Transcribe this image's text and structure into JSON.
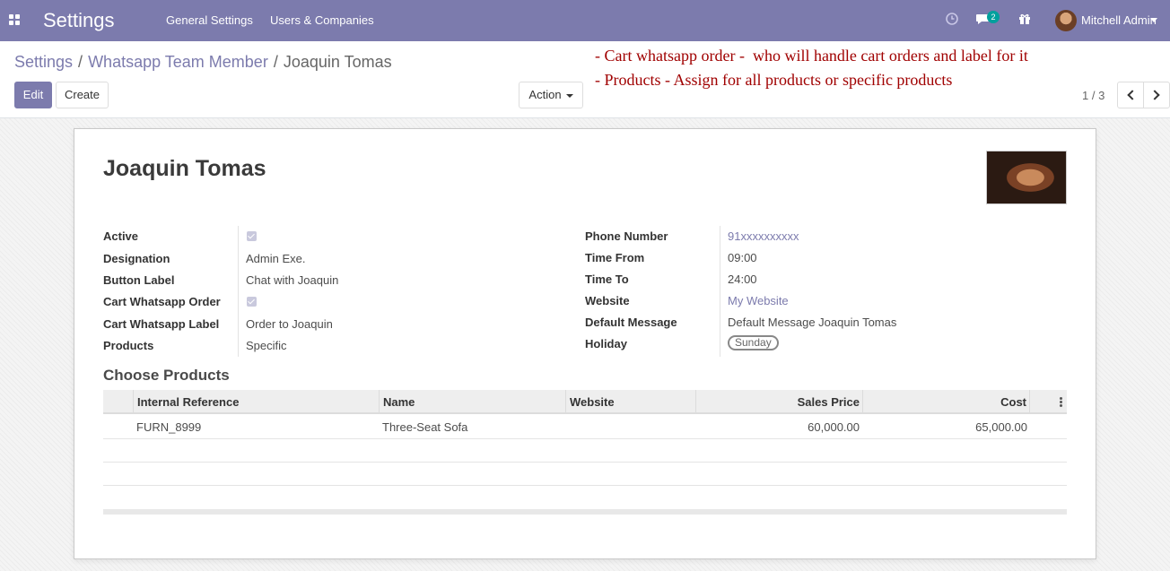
{
  "navbar": {
    "brand": "Settings",
    "menu": [
      "General Settings",
      "Users & Companies"
    ],
    "chat_count": "2",
    "user_name": "Mitchell Admin"
  },
  "breadcrumb": {
    "items": [
      "Settings",
      "Whatsapp Team Member",
      "Joaquin Tomas"
    ]
  },
  "buttons": {
    "edit": "Edit",
    "create": "Create",
    "action": "Action"
  },
  "pager": {
    "value": "1 / 3"
  },
  "annotations": [
    "- Cart whatsapp order -  who will handle cart orders and label for it",
    "- Products - Assign for all products or specific products"
  ],
  "record": {
    "name": "Joaquin Tomas",
    "left_fields": [
      {
        "label": "Active",
        "value": true
      },
      {
        "label": "Designation",
        "value": "Admin Exe."
      },
      {
        "label": "Button Label",
        "value": "Chat with Joaquin"
      },
      {
        "label": "Cart Whatsapp Order",
        "value": true
      },
      {
        "label": "Cart Whatsapp Label",
        "value": "Order to Joaquin"
      },
      {
        "label": "Products",
        "value": "Specific"
      }
    ],
    "right_fields": [
      {
        "label": "Phone Number",
        "value": "91xxxxxxxxxx"
      },
      {
        "label": "Time From",
        "value": "09:00"
      },
      {
        "label": "Time To",
        "value": "24:00"
      },
      {
        "label": "Website",
        "value": "My Website"
      },
      {
        "label": "Default Message",
        "value": "Default Message Joaquin Tomas"
      },
      {
        "label": "Holiday",
        "value": "Sunday"
      }
    ]
  },
  "products_section": {
    "title": "Choose Products",
    "columns": [
      "Internal Reference",
      "Name",
      "Website",
      "Sales Price",
      "Cost"
    ],
    "rows": [
      {
        "internal_reference": "FURN_8999",
        "name": "Three-Seat Sofa",
        "website": "",
        "sales_price": "60,000.00",
        "cost": "65,000.00"
      }
    ]
  },
  "colors": {
    "navbar": "#7c7bad",
    "accent": "#7c7bad",
    "annotation": "#a00000",
    "badge": "#00a09d"
  }
}
